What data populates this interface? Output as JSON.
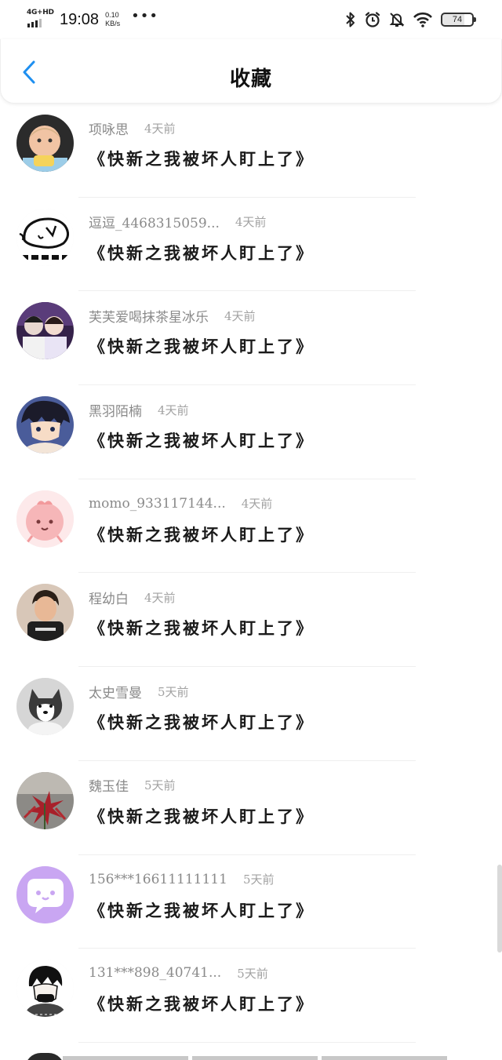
{
  "status_bar": {
    "network": "4G+HD",
    "time": "19:08",
    "speed_value": "0.10",
    "speed_unit": "KB/s",
    "more": "•••",
    "battery": "74"
  },
  "header": {
    "title": "收藏",
    "back_icon": "chevron-left-icon",
    "accent_color": "#1e8ff0"
  },
  "favorites": [
    {
      "username": "项咏思",
      "time_ago": "4天前",
      "title": "《快新之我被坏人盯上了》"
    },
    {
      "username": "逗逗_4468315059...",
      "time_ago": "4天前",
      "title": "《快新之我被坏人盯上了》"
    },
    {
      "username": "芙芙爱喝抹茶星冰乐",
      "time_ago": "4天前",
      "title": "《快新之我被坏人盯上了》"
    },
    {
      "username": "黑羽陌楠",
      "time_ago": "4天前",
      "title": "《快新之我被坏人盯上了》"
    },
    {
      "username": "momo_933117144...",
      "time_ago": "4天前",
      "title": "《快新之我被坏人盯上了》"
    },
    {
      "username": "程幼白",
      "time_ago": "4天前",
      "title": "《快新之我被坏人盯上了》"
    },
    {
      "username": "太史雪曼",
      "time_ago": "5天前",
      "title": "《快新之我被坏人盯上了》"
    },
    {
      "username": "魏玉佳",
      "time_ago": "5天前",
      "title": "《快新之我被坏人盯上了》"
    },
    {
      "username": "156***16611111111",
      "time_ago": "5天前",
      "title": "《快新之我被坏人盯上了》"
    },
    {
      "username": "131***898_40741...",
      "time_ago": "5天前",
      "title": "《快新之我被坏人盯上了》"
    }
  ]
}
